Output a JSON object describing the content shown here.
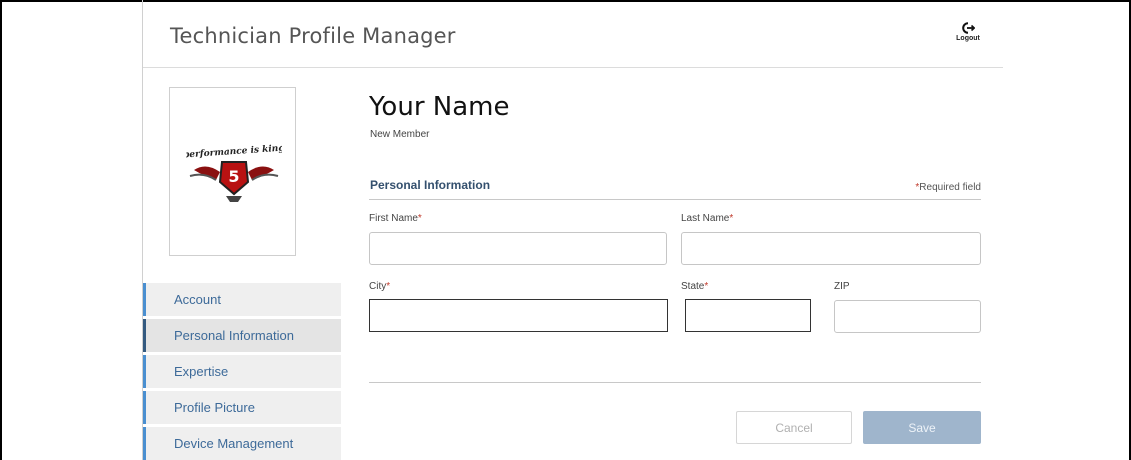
{
  "header": {
    "title": "Technician Profile Manager",
    "logout_label": "Logout"
  },
  "profile": {
    "logo_text": "performance is king",
    "logo_badge": "5"
  },
  "sidebar": {
    "items": [
      {
        "label": "Account"
      },
      {
        "label": "Personal Information"
      },
      {
        "label": "Expertise"
      },
      {
        "label": "Profile Picture"
      },
      {
        "label": "Device Management"
      }
    ],
    "active": "Personal Information"
  },
  "main": {
    "name": "Your Name",
    "role": "New Member",
    "section_title": "Personal Information",
    "required_marker": "*",
    "required_note": "Required field",
    "fields": {
      "first_name": {
        "label": "First Name",
        "required": true,
        "value": ""
      },
      "last_name": {
        "label": "Last Name",
        "required": true,
        "value": ""
      },
      "city": {
        "label": "City",
        "required": true,
        "value": ""
      },
      "state": {
        "label": "State",
        "required": true,
        "value": ""
      },
      "zip": {
        "label": "ZIP",
        "required": false,
        "value": ""
      }
    },
    "cancel_label": "Cancel",
    "save_label": "Save"
  },
  "colors": {
    "nav_accent": "#4a8fd0",
    "section_title": "#34506e",
    "required": "#c0392b",
    "save_button": "#9fb5cc"
  }
}
